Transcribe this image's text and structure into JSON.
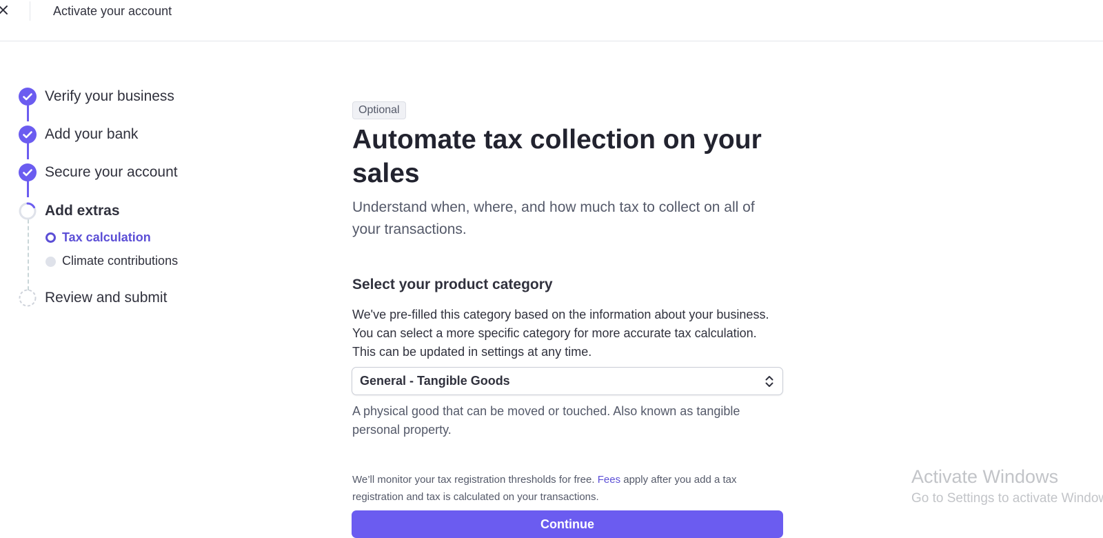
{
  "header": {
    "title": "Activate your account",
    "close_icon": "close-icon"
  },
  "stepper": {
    "steps": [
      {
        "label": "Verify your business",
        "status": "complete"
      },
      {
        "label": "Add your bank",
        "status": "complete"
      },
      {
        "label": "Secure your account",
        "status": "complete"
      },
      {
        "label": "Add extras",
        "status": "in-progress",
        "substeps": [
          {
            "label": "Tax calculation",
            "status": "active"
          },
          {
            "label": "Climate contributions",
            "status": "pending"
          }
        ]
      },
      {
        "label": "Review and submit",
        "status": "pending"
      }
    ]
  },
  "main": {
    "badge": "Optional",
    "title": "Automate tax collection on your sales",
    "subtitle": "Understand when, where, and how much tax to collect on all of your transactions.",
    "section_title": "Select your product category",
    "section_description": "We've pre-filled this category based on the information about your business. You can select a more specific category for more accurate tax calculation. This can be updated in settings at any time.",
    "category_select": {
      "value": "General - Tangible Goods",
      "help": "A physical good that can be moved or touched. Also known as tangible personal property."
    },
    "footnote": {
      "before": "We’ll monitor your tax registration thresholds for free.",
      "link": "Fees",
      "after": "apply after you add a tax registration and tax is calculated on your transactions."
    },
    "continue_label": "Continue"
  },
  "watermark": {
    "title": "Activate Windows",
    "subtitle": "Go to Settings to activate Windows."
  },
  "colors": {
    "accent": "#6b5cf0",
    "accent_text": "#5c4fd6",
    "text": "#30313d",
    "muted": "#545969"
  }
}
